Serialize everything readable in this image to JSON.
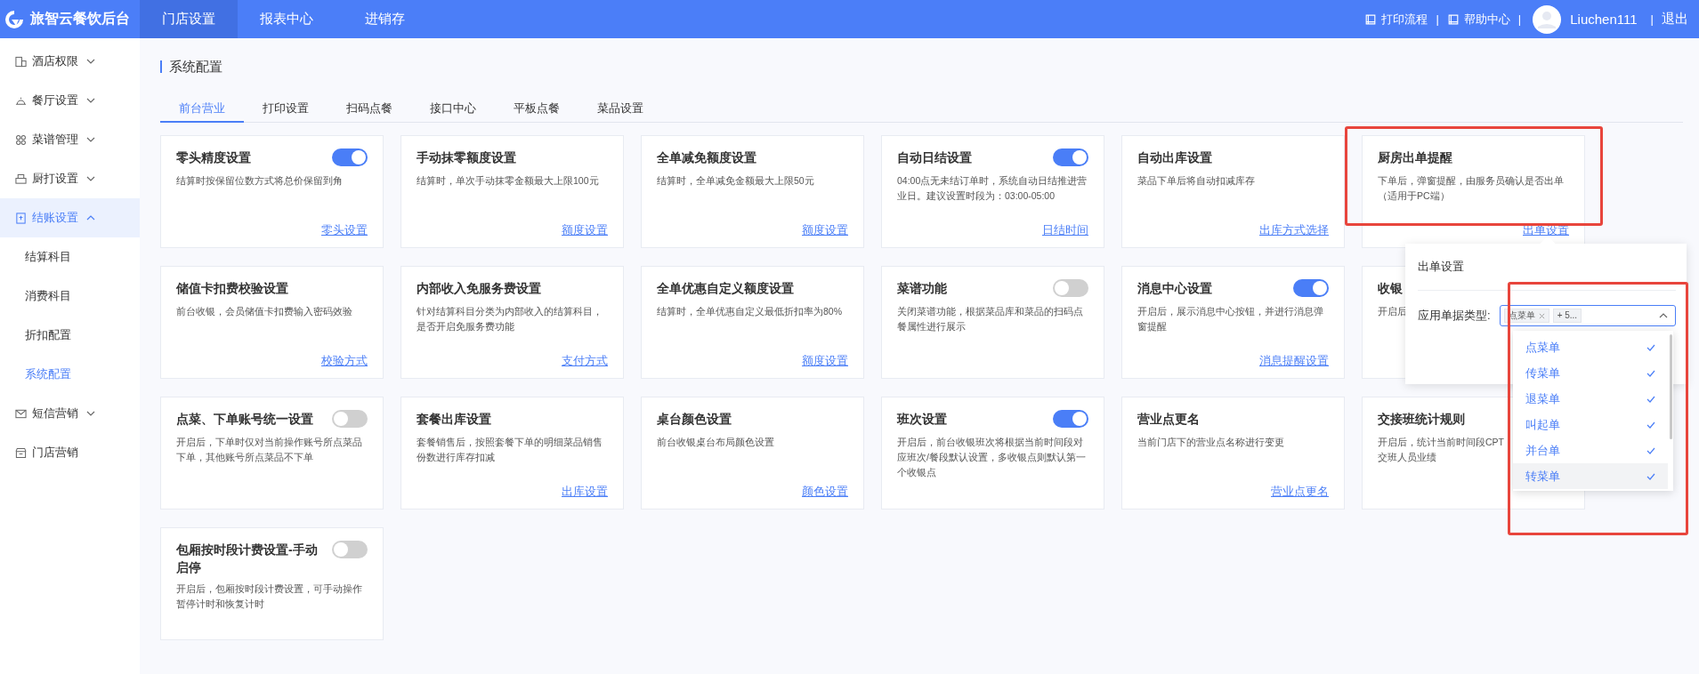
{
  "header": {
    "brand": "旅智云餐饮后台",
    "nav": [
      {
        "label": "门店设置",
        "selected": true
      },
      {
        "label": "报表中心",
        "selected": false
      },
      {
        "label": "进销存",
        "selected": false
      }
    ],
    "right": [
      {
        "kind": "book-link",
        "text": "打印流程"
      },
      {
        "kind": "sep",
        "text": "|"
      },
      {
        "kind": "book-link",
        "text": "帮助中心"
      },
      {
        "kind": "sep",
        "text": "|"
      },
      {
        "kind": "avatar"
      },
      {
        "kind": "user",
        "text": "Liuchen111"
      },
      {
        "kind": "sep",
        "text": "|"
      },
      {
        "kind": "link",
        "text": "退出"
      }
    ]
  },
  "sidebar": {
    "items": [
      {
        "label": "酒店权限",
        "selected": false,
        "expanded": false
      },
      {
        "label": "餐厅设置",
        "selected": false,
        "expanded": false
      },
      {
        "label": "菜谱管理",
        "selected": false,
        "expanded": false
      },
      {
        "label": "厨打设置",
        "selected": false,
        "expanded": false
      },
      {
        "label": "结账设置",
        "selected": true,
        "expanded": true,
        "children": [
          {
            "label": "结算科目",
            "selected": false
          },
          {
            "label": "消费科目",
            "selected": false
          },
          {
            "label": "折扣配置",
            "selected": false
          },
          {
            "label": "系统配置",
            "selected": true
          }
        ]
      },
      {
        "label": "短信营销",
        "selected": false,
        "expanded": false
      },
      {
        "label": "门店营销",
        "selected": false
      }
    ]
  },
  "page_title": "系统配置",
  "tabs": [
    {
      "label": "前台营业",
      "selected": true
    },
    {
      "label": "打印设置",
      "selected": false
    },
    {
      "label": "扫码点餐",
      "selected": false
    },
    {
      "label": "接口中心",
      "selected": false
    },
    {
      "label": "平板点餐",
      "selected": false
    },
    {
      "label": "菜品设置",
      "selected": false
    }
  ],
  "cards": [
    {
      "title": "零头精度设置",
      "on": true,
      "desc": [
        "结算时按保留位数方式将总价保留到角"
      ],
      "link": "零头设置"
    },
    {
      "title": "手动抹零额度设置",
      "desc": [
        "结算时，单次手动抹零金额最大上限100元"
      ],
      "link": "额度设置"
    },
    {
      "title": "全单减免额度设置",
      "desc": [
        "结算时，全单减免金额最大上限50元"
      ],
      "link": "额度设置"
    },
    {
      "title": "自动日结设置",
      "on": true,
      "desc": [
        "04:00点无未结订单时，系统自动日结推进营",
        "业日。建议设置时段为：03:00-05:00"
      ],
      "link": "日结时间"
    },
    {
      "title": "自动出库设置",
      "desc": [
        "菜品下单后将自动扣减库存"
      ],
      "link": "出库方式选择"
    },
    {
      "title": "厨房出单提醒",
      "desc": [
        "下单后，弹窗提醒，由服务员确认是否出单",
        "（适用于PC端）"
      ],
      "link": "出单设置"
    },
    {
      "title": "储值卡扣费校验设置",
      "desc": [
        "前台收银，会员储值卡扣费输入密码效验"
      ],
      "link": "校验方式"
    },
    {
      "title": "内部收入免服务费设置",
      "desc": [
        "针对结算科目分类为内部收入的结算科目，",
        "是否开启免服务费功能"
      ],
      "link": "支付方式"
    },
    {
      "title": "全单优惠自定义额度设置",
      "desc": [
        "结算时，全单优惠自定义最低折扣率为80%"
      ],
      "link": "额度设置"
    },
    {
      "title": "菜谱功能",
      "on": false,
      "desc": [
        "关闭菜谱功能，根据菜品库和菜品的扫码点",
        "餐属性进行展示"
      ]
    },
    {
      "title": "消息中心设置",
      "on": true,
      "desc": [
        "开启后，展示消息中心按钮，并进行消息弹",
        "窗提醒"
      ],
      "link": "消息提醒设置"
    },
    {
      "title": "收银",
      "desc": [
        "开启后"
      ]
    },
    {
      "title": "点菜、下单账号统一设置",
      "on": false,
      "desc": [
        "开启后，下单时仅对当前操作账号所点菜品",
        "下单，其他账号所点菜品不下单"
      ]
    },
    {
      "title": "套餐出库设置",
      "desc": [
        "套餐销售后，按照套餐下单的明细菜品销售",
        "份数进行库存扣减"
      ],
      "link": "出库设置"
    },
    {
      "title": "桌台颜色设置",
      "desc": [
        "前台收银桌台布局颜色设置"
      ],
      "link": "颜色设置"
    },
    {
      "title": "班次设置",
      "on": true,
      "desc": [
        "开启后，前台收银班次将根据当前时间段对",
        "应班次/餐段默认设置，多收银点则默认第一",
        "个收银点"
      ]
    },
    {
      "title": "营业点更名",
      "desc": [
        "当前门店下的营业点名称进行变更"
      ],
      "link": "营业点更名"
    },
    {
      "title": "交接班统计规则",
      "desc": [
        "开启后，统计当前时间段CPT",
        "交班人员业绩"
      ]
    },
    {
      "title": "包厢按时段计费设置-手动启停",
      "on": false,
      "desc": [
        "开启后，包厢按时段计费设置，可手动操作",
        "暂停计时和恢复计时"
      ]
    }
  ],
  "popover": {
    "title": "出单设置",
    "field_label": "应用单据类型:",
    "tags": [
      "点菜单"
    ],
    "more_tag": "+ 5...",
    "expanded": true,
    "options": [
      {
        "label": "点菜单",
        "selected": true,
        "highlighted": false
      },
      {
        "label": "传菜单",
        "selected": true,
        "highlighted": false
      },
      {
        "label": "退菜单",
        "selected": true,
        "highlighted": false
      },
      {
        "label": "叫起单",
        "selected": true,
        "highlighted": false
      },
      {
        "label": "并台单",
        "selected": true,
        "highlighted": false
      },
      {
        "label": "转菜单",
        "selected": true,
        "highlighted": true
      }
    ]
  }
}
